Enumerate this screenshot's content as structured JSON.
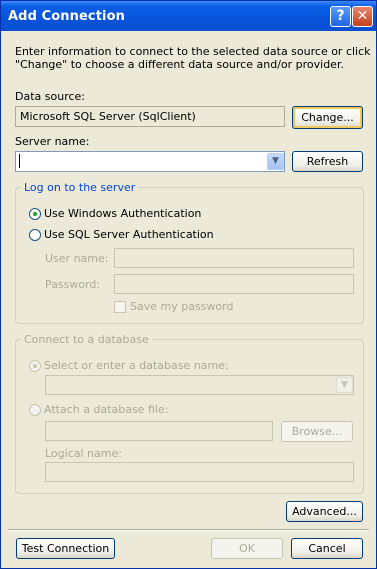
{
  "window": {
    "title": "Add Connection",
    "help_glyph": "?",
    "close_glyph": "✕"
  },
  "intro": {
    "line1": "Enter information to connect to the selected data source or click",
    "line2": "\"Change\" to choose a different data source and/or provider."
  },
  "data_source": {
    "label": "Data source:",
    "value": "Microsoft SQL Server (SqlClient)",
    "change_label": "Change..."
  },
  "server": {
    "label": "Server name:",
    "value": "",
    "refresh_label": "Refresh"
  },
  "logon": {
    "title": "Log on to the server",
    "windows_auth_label": "Use Windows Authentication",
    "sql_auth_label": "Use SQL Server Authentication",
    "selected": "windows",
    "user_label": "User name:",
    "password_label": "Password:",
    "save_password_label": "Save my password"
  },
  "database": {
    "title": "Connect to a database",
    "select_label": "Select or enter a database name:",
    "attach_label": "Attach a database file:",
    "browse_label": "Browse...",
    "logical_label": "Logical name:"
  },
  "buttons": {
    "advanced": "Advanced...",
    "test": "Test Connection",
    "ok": "OK",
    "cancel": "Cancel"
  },
  "colors": {
    "title_bar": "#0a5fe4",
    "dialog_bg": "#ece9d8",
    "group_title": "#0046d5",
    "disabled_text": "#aca899"
  }
}
